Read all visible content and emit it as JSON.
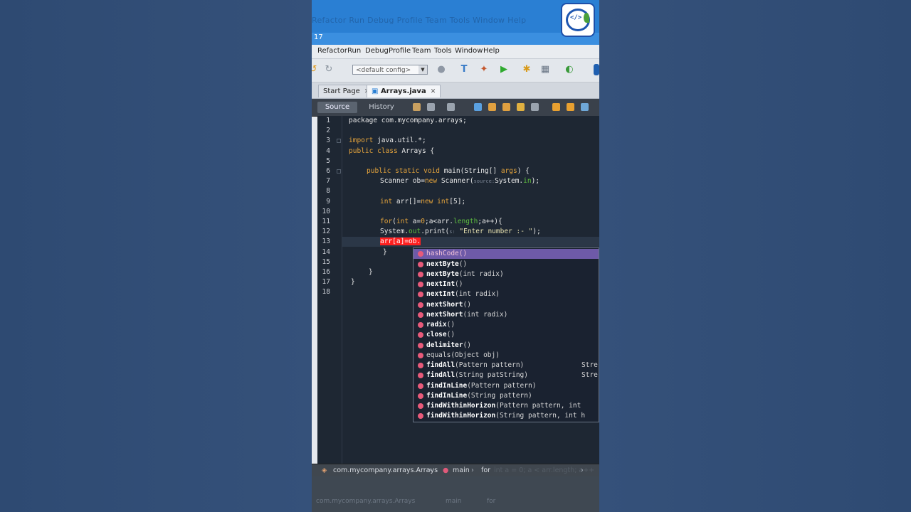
{
  "window": {
    "title_number": "17",
    "ghost_menu": "Refactor  Run  Debug  Profile  Team  Tools  Window  Help"
  },
  "menu": [
    "Refactor",
    "Run",
    "Debug",
    "Profile",
    "Team",
    "Tools",
    "Window",
    "Help"
  ],
  "toolbar": {
    "config_value": "<default config>"
  },
  "tabs": [
    {
      "label": "Start Page",
      "active": false
    },
    {
      "label": "Arrays.java",
      "active": true
    }
  ],
  "editor_bar": {
    "source": "Source",
    "history": "History"
  },
  "lines": [
    "1",
    "2",
    "3",
    "4",
    "5",
    "6",
    "7",
    "8",
    "9",
    "10",
    "11",
    "12",
    "13",
    "14",
    "15",
    "16",
    "17",
    "18"
  ],
  "code": {
    "l1": "package com.mycompany.arrays;",
    "l3_kw": "import",
    "l3_rest": " java.util.*;",
    "l4_kw1": "public",
    "l4_kw2": "class",
    "l4_rest": " Arrays {",
    "l6_kw1": "public",
    "l6_kw2": "static",
    "l6_kw3": "void",
    "l6_rest": " main(String[] ",
    "l6_arg": "args",
    "l6_end": ") {",
    "l7_a": "Scanner ob=",
    "l7_new": "new",
    "l7_b": " Scanner(",
    "l7_hint": "source:",
    "l7_c": "System.",
    "l7_in": "in",
    "l7_d": ");",
    "l9_int": "int",
    "l9_a": " arr[]=",
    "l9_new": "new",
    "l9_int2": " int",
    "l9_b": "[5];",
    "l11_for": "for",
    "l11_a": "(",
    "l11_int": "int",
    "l11_b": " a=",
    "l11_zero": "0",
    "l11_c": ";a<arr.",
    "l11_len": "length",
    "l11_d": ";a++){",
    "l12_a": "System.",
    "l12_out": "out",
    "l12_b": ".print(",
    "l12_hint": "s:",
    "l12_str": " \"Enter number :- \"",
    "l12_c": ");",
    "l13": "arr[a]=ob.",
    "l14": "}",
    "l16": "}",
    "l17": "}"
  },
  "completion": [
    {
      "name": "hashCode",
      "params": "()",
      "ret": "",
      "bold": false,
      "selected": true
    },
    {
      "name": "nextByte",
      "params": "()",
      "ret": "",
      "bold": true,
      "selected": false
    },
    {
      "name": "nextByte",
      "params": "(int radix)",
      "ret": "",
      "bold": true,
      "selected": false
    },
    {
      "name": "nextInt",
      "params": "()",
      "ret": "",
      "bold": true,
      "selected": false
    },
    {
      "name": "nextInt",
      "params": "(int radix)",
      "ret": "",
      "bold": true,
      "selected": false
    },
    {
      "name": "nextShort",
      "params": "()",
      "ret": "",
      "bold": true,
      "selected": false
    },
    {
      "name": "nextShort",
      "params": "(int radix)",
      "ret": "",
      "bold": true,
      "selected": false
    },
    {
      "name": "radix",
      "params": "()",
      "ret": "",
      "bold": true,
      "selected": false
    },
    {
      "name": "close",
      "params": "()",
      "ret": "",
      "bold": true,
      "selected": false
    },
    {
      "name": "delimiter",
      "params": "()",
      "ret": "",
      "bold": true,
      "selected": false
    },
    {
      "name": "equals",
      "params": "(Object obj)",
      "ret": "",
      "bold": false,
      "selected": false
    },
    {
      "name": "findAll",
      "params": "(Pattern pattern)",
      "ret": "Stre",
      "bold": true,
      "selected": false
    },
    {
      "name": "findAll",
      "params": "(String patString)",
      "ret": "Stre",
      "bold": true,
      "selected": false
    },
    {
      "name": "findInLine",
      "params": "(Pattern pattern)",
      "ret": "",
      "bold": true,
      "selected": false
    },
    {
      "name": "findInLine",
      "params": "(String pattern)",
      "ret": "",
      "bold": true,
      "selected": false
    },
    {
      "name": "findWithinHorizon",
      "params": "(Pattern pattern, int",
      "ret": "",
      "bold": true,
      "selected": false
    },
    {
      "name": "findWithinHorizon",
      "params": "(String pattern, int h",
      "ret": "",
      "bold": true,
      "selected": false
    }
  ],
  "navigator": {
    "class_path": "com.mycompany.arrays.Arrays",
    "method": "main",
    "block": "for",
    "faded": "int a = 0; a < arr.length; a++"
  },
  "status_ghost": {
    "path": "com.mycompany.arrays.Arrays",
    "method": "main",
    "block": "for"
  },
  "colors": {
    "keyword": "#e5a43c",
    "field": "#5fbf3f",
    "error_bg": "#ff1f1f",
    "selection": "#6e5aa8",
    "title_blue": "#2a7fd3"
  }
}
